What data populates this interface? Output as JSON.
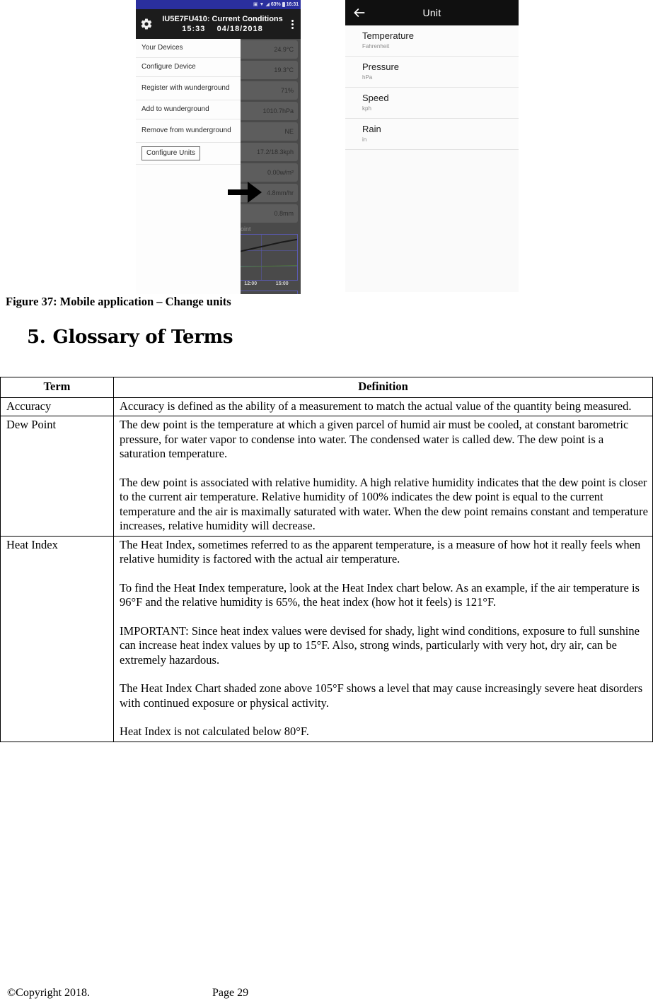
{
  "figure": {
    "caption": "Figure 37: Mobile application – Change units",
    "left_phone": {
      "status_bar": {
        "battery_percent": "63%",
        "clock": "16:31"
      },
      "app_bar": {
        "title_line1": "IU5E7FU410: Current Conditions",
        "time": "15:33",
        "date": "04/18/2018"
      },
      "menu_items": [
        "Your Devices",
        "Configure Device",
        "Register with wunderground",
        "Add to wunderground",
        "Remove from wunderground",
        "Configure Units"
      ],
      "readings": [
        "24.9°C",
        "19.3°C",
        "71%",
        "1010.7hPa",
        "NE",
        "17.2/18.3kph",
        "0.00w/m²",
        "4.8mm/hr",
        "0.8mm"
      ],
      "chart": {
        "label": "Point",
        "ticks": [
          "12:00",
          "15:00"
        ]
      }
    },
    "right_phone": {
      "title": "Unit",
      "items": [
        {
          "name": "Temperature",
          "value": "Fahrenheit"
        },
        {
          "name": "Pressure",
          "value": "hPa"
        },
        {
          "name": "Speed",
          "value": "kph"
        },
        {
          "name": "Rain",
          "value": "in"
        }
      ]
    }
  },
  "section": {
    "number": "5.",
    "title": "Glossary of Terms"
  },
  "table": {
    "headers": [
      "Term",
      "Definition"
    ],
    "rows": [
      {
        "term": "Accuracy",
        "paragraphs": [
          "Accuracy is defined as the ability of a measurement to match the actual value of the quantity being measured."
        ]
      },
      {
        "term": "Dew Point",
        "paragraphs": [
          "The dew point is the temperature at which a given parcel of humid air must be cooled, at constant barometric pressure, for water vapor to condense into water. The condensed water is called dew. The dew point is a saturation temperature.",
          "The dew point is associated with relative humidity. A high relative humidity indicates that the dew point is closer to the current air temperature. Relative humidity of 100% indicates the dew point is equal to the current temperature and the air is maximally saturated with water. When the dew point remains constant and temperature increases, relative humidity will decrease."
        ]
      },
      {
        "term": "Heat Index",
        "paragraphs": [
          "The Heat Index, sometimes referred to as the apparent temperature, is a measure of how hot it really feels when relative humidity is factored with the actual air temperature.",
          "To find the Heat Index temperature, look at the Heat Index chart below. As an example, if the air temperature is 96°F and the relative humidity is 65%, the heat index (how hot it feels) is 121°F.",
          "IMPORTANT: Since heat index values were devised for shady, light wind conditions, exposure to full sunshine can increase heat index values by up to 15°F. Also, strong winds, particularly with very hot, dry air, can be extremely hazardous.",
          "The Heat Index Chart shaded zone above 105°F shows a level that may cause increasingly severe heat disorders with continued exposure or physical activity.",
          "Heat Index is not calculated below 80°F."
        ]
      }
    ]
  },
  "footer": {
    "copyright": "©Copyright 2018.",
    "page": "Page 29"
  }
}
